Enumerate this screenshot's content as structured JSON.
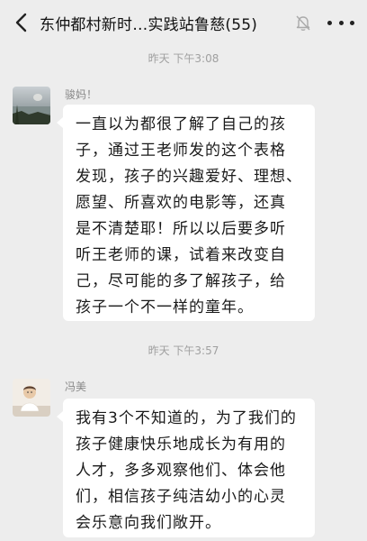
{
  "header": {
    "title": "东仲都村新时…实践站鲁慈(55)",
    "back_icon": "chevron-left-icon",
    "mute_icon": "bell-muted-icon",
    "more_icon": "more-dots-icon"
  },
  "messages": [
    {
      "timestamp": "昨天 下午3:08",
      "sender": "骏妈！",
      "lines": [
        "一直以为都很了解了自己的孩",
        "子，通过王老师发的这个表格",
        "发现，孩子的兴趣爱好、理想、",
        "愿望、所喜欢的电影等，还真",
        "是不清楚耶！所以以后要多听",
        "听王老师的课，试着来改变自",
        "己，尽可能的多了解孩子，给",
        "孩子一个不一样的童年。"
      ]
    },
    {
      "timestamp": "昨天 下午3:57",
      "sender": "冯美",
      "lines": [
        "我有3个不知道的，为了我们的",
        "孩子健康快乐地成长为有用的",
        "人才，多多观察他们、体会他",
        "们，相信孩子纯洁幼小的心灵",
        "会乐意向我们敞开。"
      ]
    }
  ]
}
